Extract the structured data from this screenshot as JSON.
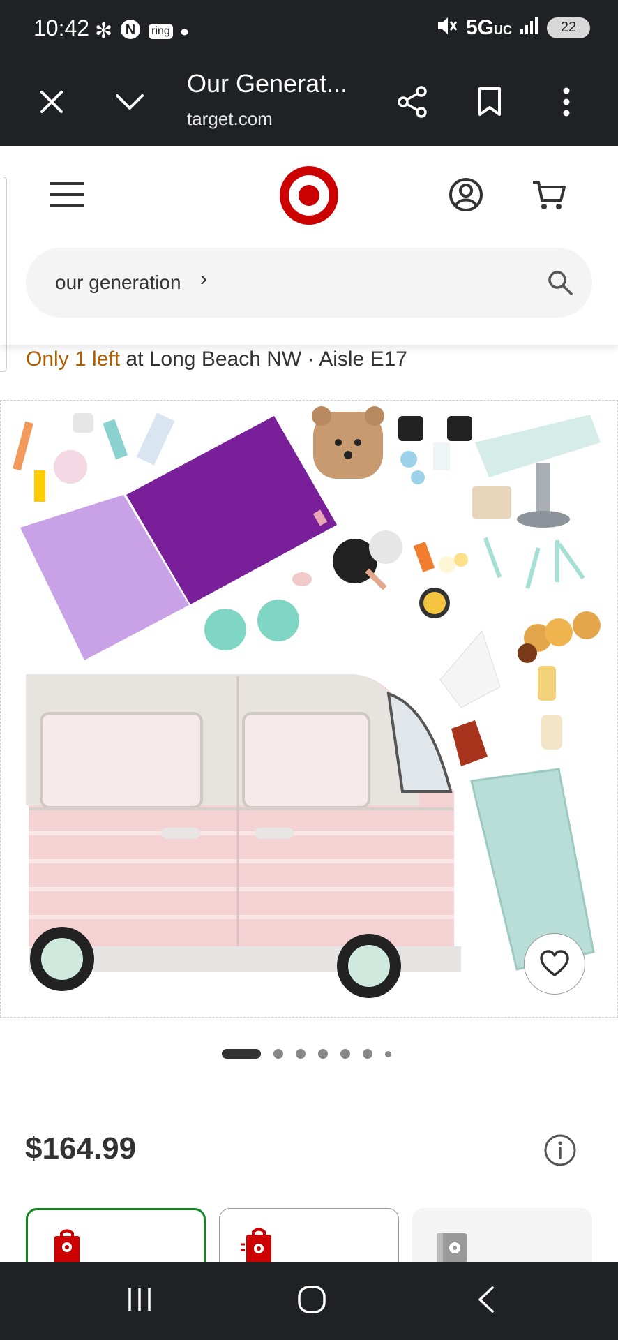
{
  "status_bar": {
    "time": "10:42",
    "ring_label": "ring",
    "network": "5G",
    "network_sub": "UC",
    "battery": "22"
  },
  "browser": {
    "tab_title": "Our Generat...",
    "url": "target.com"
  },
  "site": {
    "search_query": "our generation"
  },
  "stock": {
    "highlight": "Only 1 left",
    "rest": " at Long Beach NW · Aisle E17"
  },
  "product": {
    "image_alt": "Our Generation pink camper van playset with accessories",
    "carousel_total": 7,
    "carousel_active": 1,
    "price": "$164.99"
  },
  "colors": {
    "target_red": "#cc0000",
    "accent_green": "#148720",
    "stock_orange": "#b05e00",
    "chrome_dark": "#202124"
  }
}
